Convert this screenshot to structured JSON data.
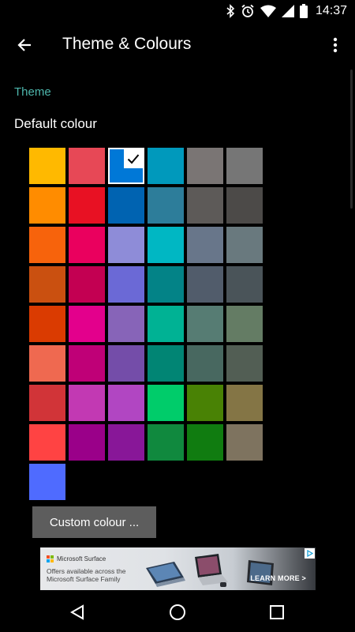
{
  "status_bar": {
    "time": "14:37"
  },
  "app_bar": {
    "title": "Theme & Colours"
  },
  "section": {
    "header": "Theme",
    "pref_title": "Default colour"
  },
  "palette": {
    "selected_index": 2,
    "rows": [
      [
        "#ffb900",
        "#e74856",
        "#0078d7",
        "#0099bc",
        "#7a7574",
        "#767676"
      ],
      [
        "#ff8c00",
        "#e81123",
        "#0063b1",
        "#2d7d9a",
        "#5d5a58",
        "#4c4a48"
      ],
      [
        "#f7630c",
        "#ea005e",
        "#8e8cd8",
        "#00b7c3",
        "#68768a",
        "#69797e"
      ],
      [
        "#ca5010",
        "#c30052",
        "#6b69d6",
        "#038387",
        "#515c6b",
        "#4a5459"
      ],
      [
        "#da3b01",
        "#e3008c",
        "#8764b8",
        "#00b294",
        "#567c73",
        "#647c64"
      ],
      [
        "#ef6950",
        "#bf0077",
        "#744da9",
        "#018574",
        "#486860",
        "#525e54"
      ],
      [
        "#d13438",
        "#c239b3",
        "#b146c2",
        "#00cc6a",
        "#498205",
        "#847545"
      ],
      [
        "#ff4343",
        "#9a0089",
        "#881798",
        "#10893e",
        "#107c10",
        "#7e735f"
      ],
      [
        "#4f6bff"
      ]
    ]
  },
  "custom_button": {
    "label": "Custom colour ..."
  },
  "ad": {
    "brand": "Microsoft Surface",
    "text": "Offers available across the Microsoft Surface Family",
    "cta": "LEARN MORE >"
  },
  "icons": {
    "back": "arrow-back-icon",
    "overflow": "more-vert-icon",
    "check": "check-icon",
    "nav_back": "nav-back-icon",
    "nav_home": "nav-home-icon",
    "nav_recents": "nav-recents-icon"
  }
}
